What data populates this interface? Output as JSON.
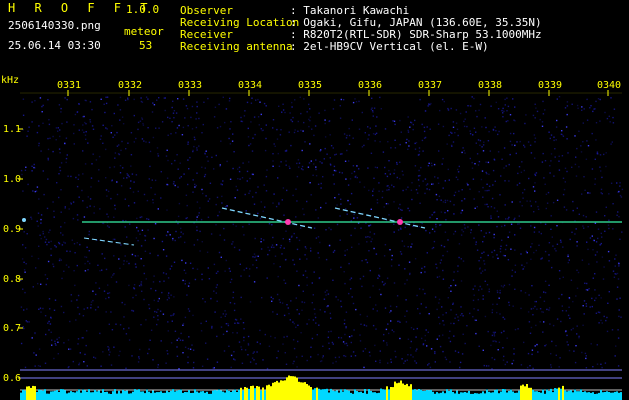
{
  "app": {
    "name": "H R O F F T",
    "version": "1.0.0"
  },
  "file": {
    "name": "2506140330.png",
    "datetime": "25.06.14 03:30"
  },
  "meteor": {
    "label": "meteor",
    "count": "53"
  },
  "station": {
    "fields": [
      {
        "label": "Observer",
        "value": ": Takanori Kawachi"
      },
      {
        "label": "Receiving Location",
        "value": ": Ogaki, Gifu, JAPAN (136.60E, 35.35N)"
      },
      {
        "label": "Receiver",
        "value": ": R820T2(RTL-SDR) SDR-Sharp 53.1000MHz"
      },
      {
        "label": "Receiving antenna",
        "value": ": 2el-HB9CV Vertical (el. E-W)"
      }
    ]
  },
  "axes": {
    "y_unit": "kHz",
    "x_ticks": [
      "0331",
      "0332",
      "0333",
      "0334",
      "0335",
      "0336",
      "0337",
      "0338",
      "0339",
      "0340"
    ],
    "y_ticks": [
      "1.1",
      "1.0",
      "0.9",
      "0.8",
      "0.7",
      "0.6"
    ]
  },
  "colors": {
    "background": "#000000",
    "header_text": "#ffff00",
    "header_info": "#ffffff",
    "noise": "#1a1aa0",
    "carrier": "#2ec98a",
    "echo": "#7fd6ff",
    "echo_core": "#ff3ab0",
    "baseline_bars": "#00d8ff",
    "baseline_peaks": "#ffff00",
    "guide_line": "#8080ff"
  }
}
